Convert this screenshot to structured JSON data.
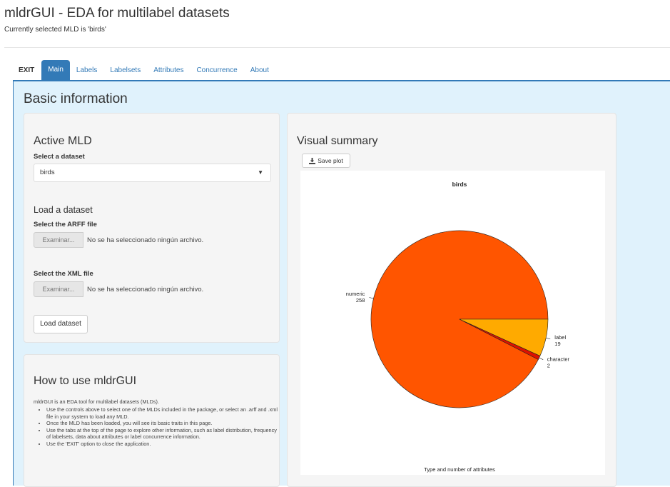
{
  "app": {
    "title": "mldrGUI - EDA for multilabel datasets",
    "subtitle": "Currently selected MLD is 'birds'"
  },
  "tabs": [
    {
      "label": "EXIT",
      "active": false
    },
    {
      "label": "Main",
      "active": true
    },
    {
      "label": "Labels",
      "active": false
    },
    {
      "label": "Labelsets",
      "active": false
    },
    {
      "label": "Attributes",
      "active": false
    },
    {
      "label": "Concurrence",
      "active": false
    },
    {
      "label": "About",
      "active": false
    }
  ],
  "main": {
    "section_title": "Basic information",
    "active_mld": {
      "heading": "Active MLD",
      "select_label": "Select a dataset",
      "selected_value": "birds"
    },
    "load_dataset": {
      "heading": "Load a dataset",
      "arff_label": "Select the ARFF file",
      "xml_label": "Select the XML file",
      "browse_label": "Examinar...",
      "arff_status": "No se ha seleccionado ningún archivo.",
      "xml_status": "No se ha seleccionado ningún archivo.",
      "load_button": "Load dataset"
    },
    "how_to": {
      "heading": "How to use mldrGUI",
      "intro": "mldrGUI is an EDA tool for multilabel datasets (MLDs).",
      "items": [
        "Use the controls above to select one of the MLDs included in the package, or select an .arff and .xml file in your system to load any MLD.",
        "Once the MLD has been loaded, you will see its basic traits in this page.",
        "Use the tabs at the top of the page to explore other information, such as label distribution, frequency of labelsets, data about attributes or label concurrence information.",
        "Use the 'EXIT' option to close the application."
      ]
    },
    "visual_summary": {
      "heading": "Visual summary",
      "save_button": "Save plot"
    }
  },
  "chart_data": {
    "type": "pie",
    "title": "birds",
    "xlabel": "Type and number of attributes",
    "slices": [
      {
        "name": "numeric",
        "value": 258,
        "color": "#ff5500"
      },
      {
        "name": "character",
        "value": 2,
        "color": "#dd1100"
      },
      {
        "name": "label",
        "value": 19,
        "color": "#ffaa00"
      }
    ]
  },
  "colors": {
    "accent": "#337ab7",
    "content_bg": "#e0f2fc",
    "well_bg": "#f5f5f5"
  },
  "icons": {
    "save": "download-icon",
    "dropdown": "caret-down-icon"
  }
}
